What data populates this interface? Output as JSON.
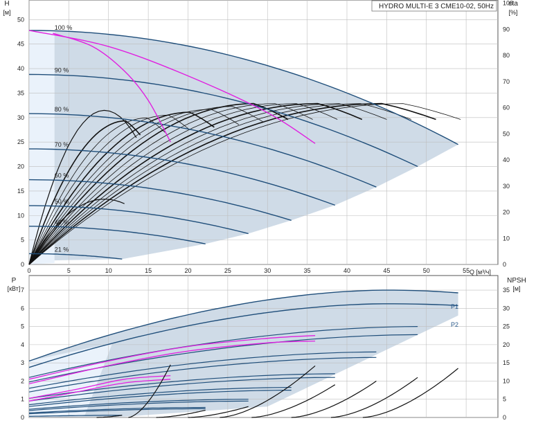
{
  "chart_data": [
    {
      "type": "line",
      "title": "HYDRO MULTI-E 3 CME10-02, 50Hz",
      "y_label_left": "H",
      "y_unit_left": "[м]",
      "y_label_right": "eta",
      "y_unit_right": "[%]",
      "x_label": "Q [м³/ч]",
      "x_ticks": [
        0,
        5,
        10,
        15,
        20,
        25,
        30,
        35,
        40,
        45,
        50,
        55
      ],
      "y_ticks_left": [
        0,
        5,
        10,
        15,
        20,
        25,
        30,
        35,
        40,
        45,
        50
      ],
      "y_ticks_right": [
        0,
        10,
        20,
        30,
        40,
        50,
        60,
        70,
        80,
        90,
        100
      ],
      "xlim": [
        0,
        59
      ],
      "ylim": [
        0,
        54
      ],
      "ylim_right": [
        0,
        101.25
      ],
      "grid": true,
      "speed_labels": [
        {
          "label": "100 %",
          "x": 3.2,
          "y": 47.5
        },
        {
          "label": "90 %",
          "x": 3.2,
          "y": 38.8
        },
        {
          "label": "80 %",
          "x": 3.2,
          "y": 30.8
        },
        {
          "label": "70 %",
          "x": 3.2,
          "y": 23.6
        },
        {
          "label": "60 %",
          "x": 3.2,
          "y": 17.3
        },
        {
          "label": "50 %",
          "x": 3.2,
          "y": 12.0
        },
        {
          "label": "40 %",
          "x": 3.2,
          "y": 7.8
        },
        {
          "label": "21 %",
          "x": 3.2,
          "y": 2.2
        }
      ],
      "head_curves": [
        {
          "speed": "100 %",
          "shutoff_head": 47.8,
          "max_flow": 54.0,
          "end_head": 24.5
        },
        {
          "speed": "90 %",
          "shutoff_head": 38.8,
          "max_flow": 48.9,
          "end_head": 20.0
        },
        {
          "speed": "80 %",
          "shutoff_head": 30.8,
          "max_flow": 43.7,
          "end_head": 15.8
        },
        {
          "speed": "70 %",
          "shutoff_head": 23.6,
          "max_flow": 38.5,
          "end_head": 12.1
        },
        {
          "speed": "60 %",
          "shutoff_head": 17.3,
          "max_flow": 33.0,
          "end_head": 9.0
        },
        {
          "speed": "50 %",
          "shutoff_head": 12.0,
          "max_flow": 27.6,
          "end_head": 6.3
        },
        {
          "speed": "40 %",
          "shutoff_head": 7.8,
          "max_flow": 22.2,
          "end_head": 4.2
        },
        {
          "speed": "21 %",
          "shutoff_head": 2.2,
          "max_flow": 11.7,
          "end_head": 1.1
        }
      ],
      "highlight_head_curve": [
        [
          0,
          47.8
        ],
        [
          10,
          44.5
        ],
        [
          20,
          38.5
        ],
        [
          30,
          31.0
        ],
        [
          36,
          24.7
        ]
      ],
      "highlight_head_curve_2": [
        [
          3,
          47.2
        ],
        [
          8,
          44.5
        ],
        [
          12,
          39.5
        ],
        [
          15,
          33.5
        ],
        [
          17.8,
          25.0
        ]
      ]
    },
    {
      "type": "line",
      "y_label_left": "P",
      "y_unit_left": "[кВт]",
      "y_label_right": "NPSH",
      "y_unit_right": "[м]",
      "y_ticks_left": [
        0,
        1,
        2,
        3,
        4,
        5,
        6,
        7
      ],
      "y_ticks_right": [
        0,
        5,
        10,
        15,
        20,
        25,
        30,
        35
      ],
      "ylim": [
        0,
        7.8
      ],
      "ylim_right": [
        0,
        39
      ],
      "grid": true,
      "series": [
        {
          "name": "P1",
          "start": 3.1,
          "peak_q": 45,
          "peak": 7.0,
          "end_q": 54.0,
          "end": 6.85
        },
        {
          "name": "P2",
          "start": 2.75,
          "peak_q": 45,
          "peak": 6.25,
          "end_q": 54.0,
          "end": 6.15
        }
      ],
      "power_curves": [
        {
          "start": 2.2,
          "end_q": 48.9,
          "end": 5.0
        },
        {
          "start": 1.95,
          "end_q": 48.9,
          "end": 4.55
        },
        {
          "start": 1.6,
          "end_q": 43.7,
          "end": 3.6
        },
        {
          "start": 1.4,
          "end_q": 43.7,
          "end": 3.3
        },
        {
          "start": 1.05,
          "end_q": 38.5,
          "end": 2.4
        },
        {
          "start": 0.9,
          "end_q": 38.5,
          "end": 2.2
        },
        {
          "start": 0.7,
          "end_q": 33.0,
          "end": 1.65
        },
        {
          "start": 0.6,
          "end_q": 33.0,
          "end": 1.5
        },
        {
          "start": 0.45,
          "end_q": 27.6,
          "end": 1.0
        },
        {
          "start": 0.38,
          "end_q": 27.6,
          "end": 0.9
        },
        {
          "start": 0.25,
          "end_q": 22.2,
          "end": 0.55
        },
        {
          "start": 0.2,
          "end_q": 22.2,
          "end": 0.48
        },
        {
          "start": 0.06,
          "end_q": 11.7,
          "end": 0.12
        }
      ],
      "highlight_power_curves": [
        [
          [
            0,
            2.1
          ],
          [
            10,
            3.1
          ],
          [
            20,
            3.9
          ],
          [
            30,
            4.35
          ],
          [
            36,
            4.5
          ]
        ],
        [
          [
            0,
            1.85
          ],
          [
            10,
            2.85
          ],
          [
            20,
            3.65
          ],
          [
            30,
            4.1
          ],
          [
            36,
            4.2
          ]
        ],
        [
          [
            0,
            1.05
          ],
          [
            6,
            1.55
          ],
          [
            12,
            2.1
          ],
          [
            17.8,
            2.3
          ]
        ],
        [
          [
            0,
            0.9
          ],
          [
            6,
            1.4
          ],
          [
            12,
            1.9
          ],
          [
            17.8,
            2.1
          ]
        ]
      ],
      "npsh_curves": [
        {
          "start_q": 12.5,
          "end_q": 17.8,
          "end": 14.5
        },
        {
          "start_q": 24.0,
          "end_q": 36.0,
          "end": 14.2
        },
        {
          "start_q": 28.0,
          "end_q": 38.5,
          "end": 9.0
        },
        {
          "start_q": 33.0,
          "end_q": 43.7,
          "end": 10.0
        },
        {
          "start_q": 38.0,
          "end_q": 48.9,
          "end": 11.0
        },
        {
          "start_q": 42.0,
          "end_q": 54.0,
          "end": 13.5
        },
        {
          "start_q": 20.0,
          "end_q": 27.6,
          "end": 3.0
        },
        {
          "start_q": 16.0,
          "end_q": 22.2,
          "end": 2.0
        },
        {
          "start_q": 8.5,
          "end_q": 11.7,
          "end": 0.6
        }
      ]
    }
  ]
}
